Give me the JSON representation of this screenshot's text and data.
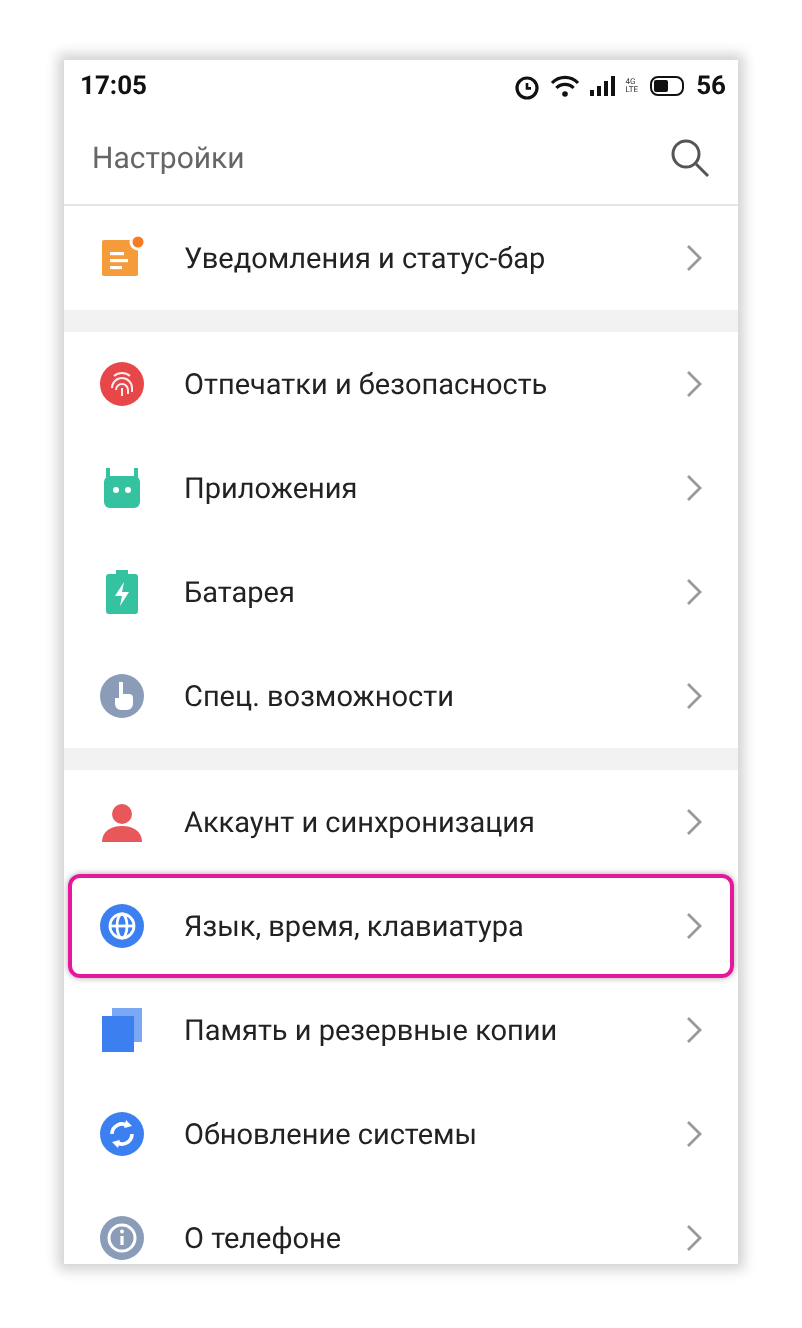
{
  "status_bar": {
    "time": "17:05",
    "network": "4G",
    "network_sub": "LTE",
    "battery": "56",
    "battery_icon": {
      "level": 0.56
    }
  },
  "header": {
    "title": "Настройки"
  },
  "groups": [
    [
      {
        "label": "Уведомления и статус-бар",
        "highlighted": false
      }
    ],
    [
      {
        "label": "Отпечатки и безопасность",
        "highlighted": false
      },
      {
        "label": "Приложения",
        "highlighted": false
      },
      {
        "label": "Батарея",
        "highlighted": false
      },
      {
        "label": "Спец. возможности",
        "highlighted": false
      }
    ],
    [
      {
        "label": "Аккаунт и синхронизация",
        "highlighted": false
      },
      {
        "label": "Язык, время, клавиатура",
        "highlighted": true
      },
      {
        "label": "Память и резервные копии",
        "highlighted": false
      },
      {
        "label": "Обновление системы",
        "highlighted": false
      },
      {
        "label": "О телефоне",
        "highlighted": false
      }
    ]
  ]
}
